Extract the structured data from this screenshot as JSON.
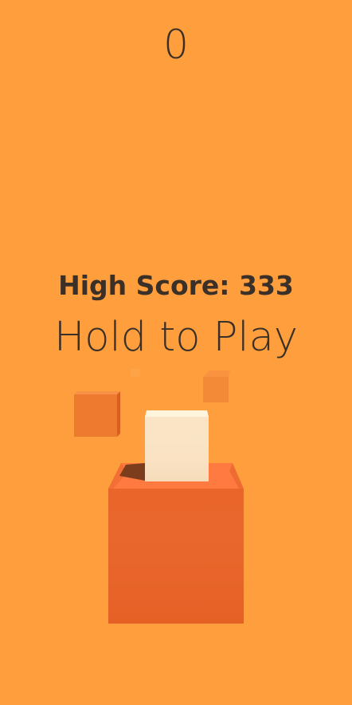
{
  "game": {
    "score": "0",
    "high_score": "High Score: 333",
    "prompt": "Hold to Play"
  },
  "colors": {
    "background": "#ff9e3d",
    "text": "#3a3028",
    "box_front": "#e96226",
    "box_top": "#ff7a40",
    "player_cube_front": "#fbe3c3",
    "player_cube_top": "#fff4dc",
    "floating_cube": "#f07a30"
  }
}
